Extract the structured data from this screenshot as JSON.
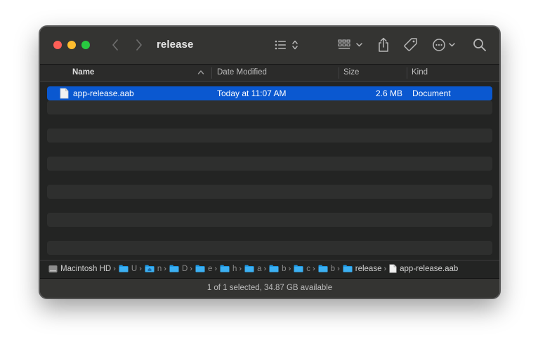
{
  "window": {
    "title": "release",
    "traffic_lights": {
      "close": "#fe5f57",
      "minimize": "#febc2e",
      "maximize": "#28c840"
    }
  },
  "toolbar": {
    "back_icon": "chevron-left-icon",
    "forward_icon": "chevron-right-icon",
    "view_icon": "list-view-icon",
    "group_icon": "grid-group-icon",
    "share_icon": "share-icon",
    "tag_icon": "tag-icon",
    "more_icon": "ellipsis-circle-icon",
    "search_icon": "magnifier-icon"
  },
  "columns": {
    "name": "Name",
    "date_modified": "Date Modified",
    "size": "Size",
    "kind": "Kind",
    "sort_column": "Name",
    "sort_direction": "ascending"
  },
  "files": [
    {
      "name": "app-release.aab",
      "date_modified": "Today at 11:07 AM",
      "size": "2.6 MB",
      "kind": "Document",
      "selected": true
    }
  ],
  "path_bar": {
    "items": [
      {
        "label": "Macintosh HD",
        "icon": "disk-icon"
      },
      {
        "label": "U",
        "icon": "folder-icon"
      },
      {
        "label": "n",
        "icon": "home-folder-icon"
      },
      {
        "label": "D",
        "icon": "folder-icon"
      },
      {
        "label": "e",
        "icon": "folder-icon"
      },
      {
        "label": "h",
        "icon": "folder-icon"
      },
      {
        "label": "a",
        "icon": "folder-icon"
      },
      {
        "label": "b",
        "icon": "folder-icon"
      },
      {
        "label": "c",
        "icon": "folder-icon"
      },
      {
        "label": "b",
        "icon": "folder-icon"
      },
      {
        "label": "release",
        "icon": "folder-icon"
      },
      {
        "label": "app-release.aab",
        "icon": "document-icon"
      }
    ]
  },
  "status": {
    "text": "1 of 1 selected, 34.87 GB available"
  },
  "colors": {
    "selection": "#0a58d0",
    "window_bg": "#232423",
    "toolbar_bg": "#343432",
    "folder": "#1e9be8"
  }
}
